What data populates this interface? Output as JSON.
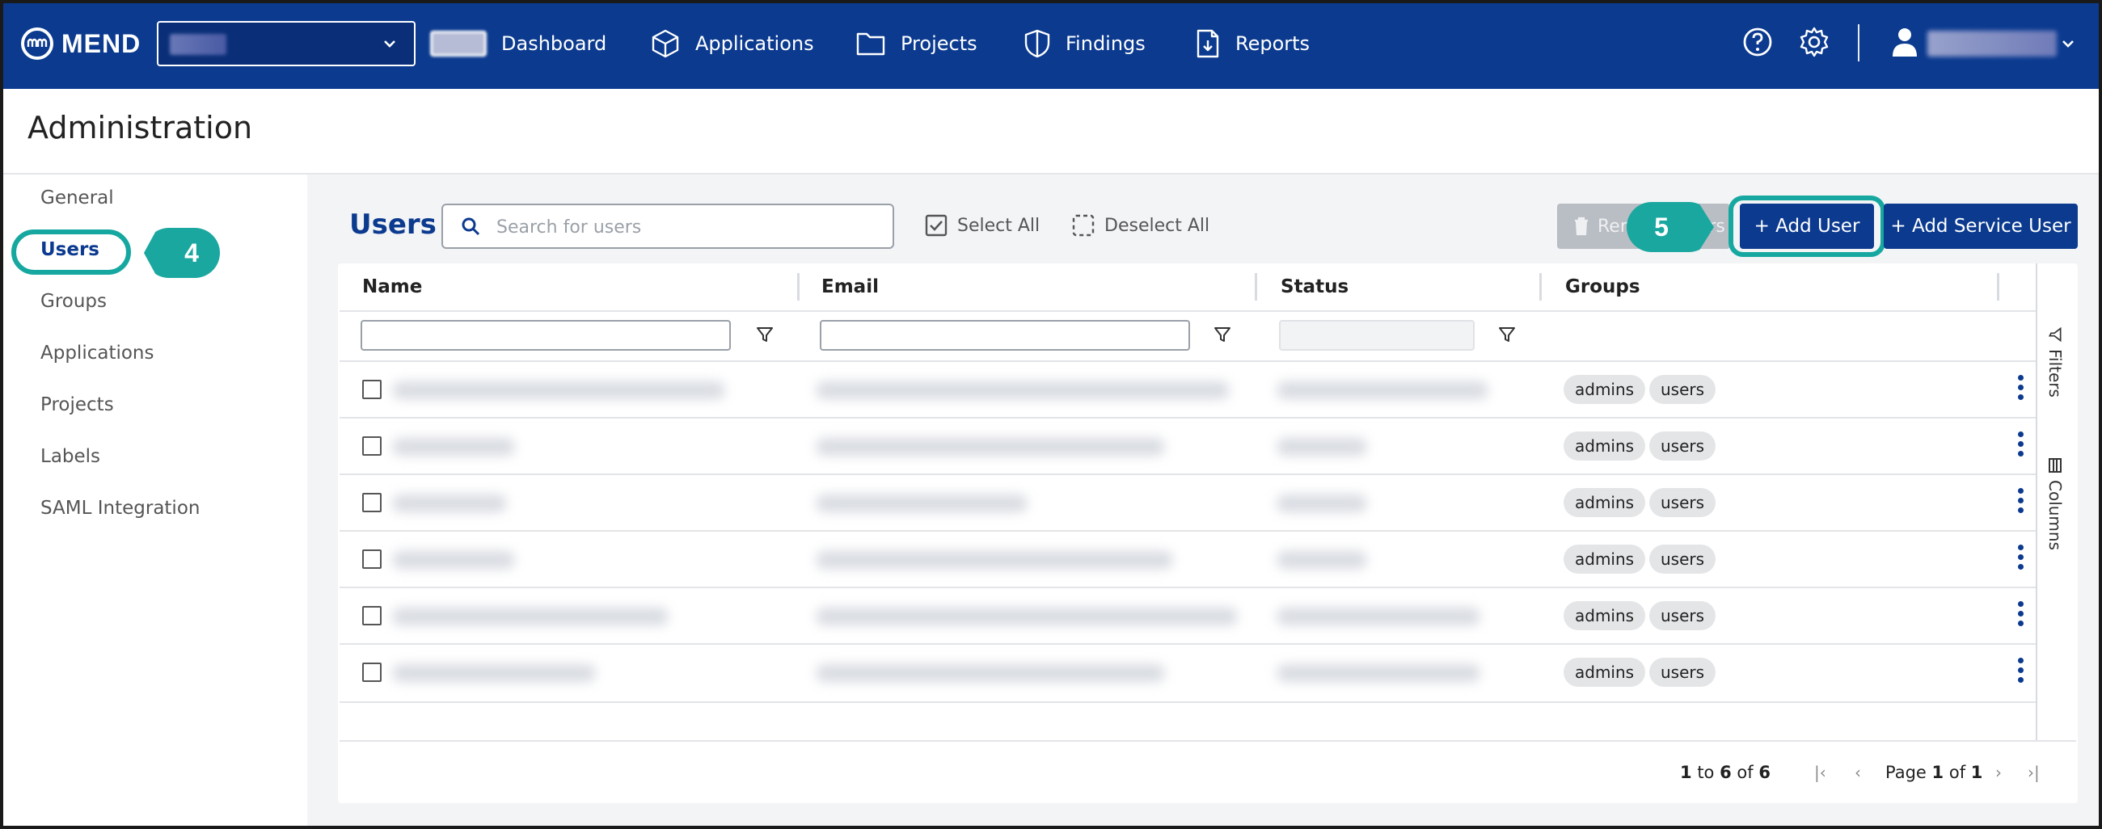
{
  "nav": {
    "brand": "MEND",
    "items": [
      {
        "label": "Dashboard",
        "icon": "dashboard-icon"
      },
      {
        "label": "Applications",
        "icon": "cube-icon"
      },
      {
        "label": "Projects",
        "icon": "folder-icon"
      },
      {
        "label": "Findings",
        "icon": "shield-icon"
      },
      {
        "label": "Reports",
        "icon": "report-icon"
      }
    ],
    "right_icons": [
      "help-icon",
      "gear-icon",
      "user-icon"
    ]
  },
  "page": {
    "title": "Administration"
  },
  "sidebar": {
    "items": [
      {
        "label": "General"
      },
      {
        "label": "Users",
        "active": true
      },
      {
        "label": "Groups"
      },
      {
        "label": "Applications"
      },
      {
        "label": "Projects"
      },
      {
        "label": "Labels"
      },
      {
        "label": "SAML Integration"
      }
    ]
  },
  "callouts": {
    "step4": "4",
    "step5": "5"
  },
  "toolbar": {
    "title": "Users",
    "search_placeholder": "Search for users",
    "select_all": "Select All",
    "deselect_all": "Deselect All",
    "remove_users": "Remove Users",
    "add_user": "+ Add User",
    "add_service_user": "+ Add Service User"
  },
  "table": {
    "columns": [
      "Name",
      "Email",
      "Status",
      "Groups"
    ],
    "rows": [
      {
        "groups": [
          "admins",
          "users"
        ]
      },
      {
        "groups": [
          "admins",
          "users"
        ]
      },
      {
        "groups": [
          "admins",
          "users"
        ]
      },
      {
        "groups": [
          "admins",
          "users"
        ]
      },
      {
        "groups": [
          "admins",
          "users"
        ]
      },
      {
        "groups": [
          "admins",
          "users"
        ]
      }
    ],
    "side_tabs": {
      "filters": "Filters",
      "columns": "Columns"
    }
  },
  "pagination": {
    "range_start": "1",
    "range_to": "to",
    "range_end": "6",
    "range_of": "of",
    "total": "6",
    "page_word": "Page",
    "page_current": "1",
    "page_of": "of",
    "page_total": "1"
  },
  "colors": {
    "brand": "#0b3a8f",
    "callout": "#16a8a0"
  }
}
